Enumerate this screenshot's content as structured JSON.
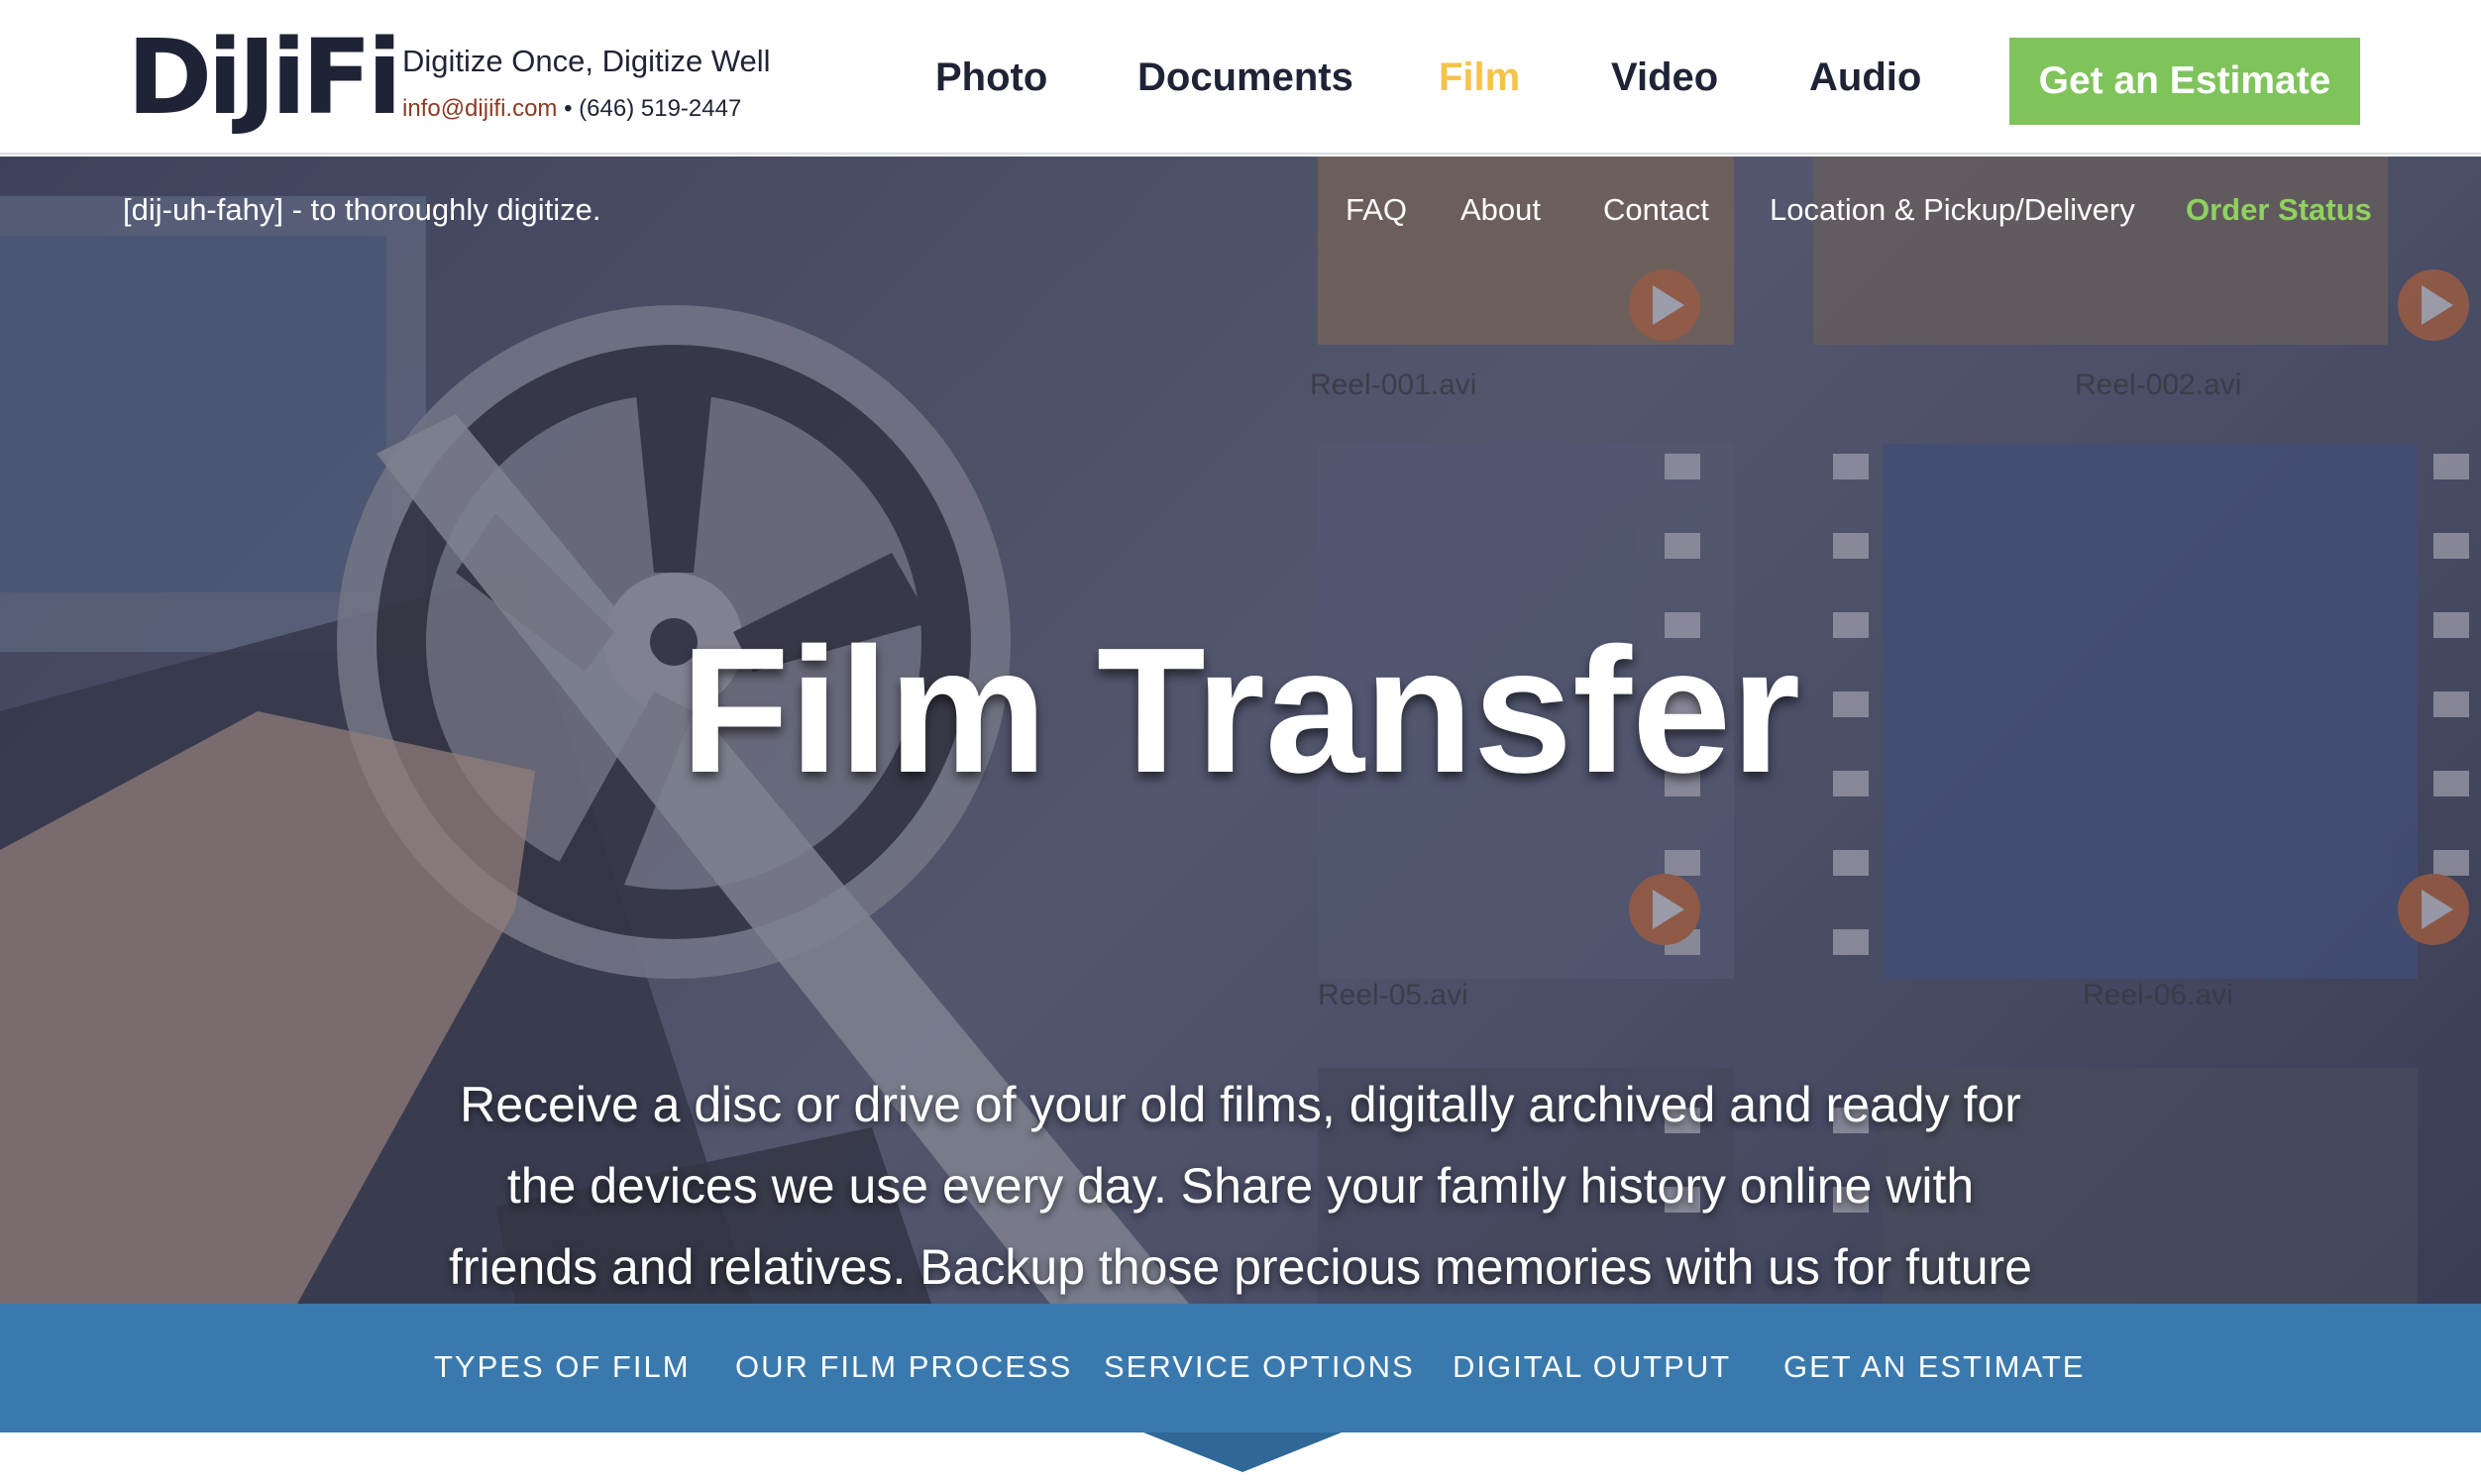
{
  "header": {
    "logo_text": "DiJiFi",
    "tagline": "Digitize Once, Digitize Well",
    "email": "info@dijifi.com",
    "separator": " • ",
    "phone": "(646) 519-2447",
    "nav": [
      {
        "label": "Photo",
        "active": false
      },
      {
        "label": "Documents",
        "active": false
      },
      {
        "label": "Film",
        "active": true
      },
      {
        "label": "Video",
        "active": false
      },
      {
        "label": "Audio",
        "active": false
      }
    ],
    "cta_label": "Get an Estimate"
  },
  "hero": {
    "pronunciation": "[dij-uh-fahy] - to thoroughly digitize.",
    "sub_nav": [
      {
        "label": "FAQ"
      },
      {
        "label": "About"
      },
      {
        "label": "Contact"
      },
      {
        "label": "Location & Pickup/Delivery"
      },
      {
        "label": "Order Status"
      }
    ],
    "title": "Film Transfer",
    "description": "Receive a disc or drive of your old films, digitally archived and ready for the devices we use every day. Share your family history online with friends and relatives. Backup those precious memories with us for future generations.",
    "reel_labels": [
      "Reel-001.avi",
      "Reel-002.avi",
      "Reel-05.avi",
      "Reel-06.avi"
    ]
  },
  "section_nav": [
    {
      "label": "TYPES OF FILM"
    },
    {
      "label": "OUR FILM PROCESS"
    },
    {
      "label": "SERVICE OPTIONS"
    },
    {
      "label": "DIGITAL OUTPUT"
    },
    {
      "label": "GET AN ESTIMATE"
    }
  ],
  "colors": {
    "brand_dark": "#1f2336",
    "accent_yellow": "#f5c34a",
    "cta_green": "#7fc35b",
    "order_status_green": "#8fd25e",
    "section_blue": "#3a79ad",
    "email_red": "#8c3a22"
  }
}
